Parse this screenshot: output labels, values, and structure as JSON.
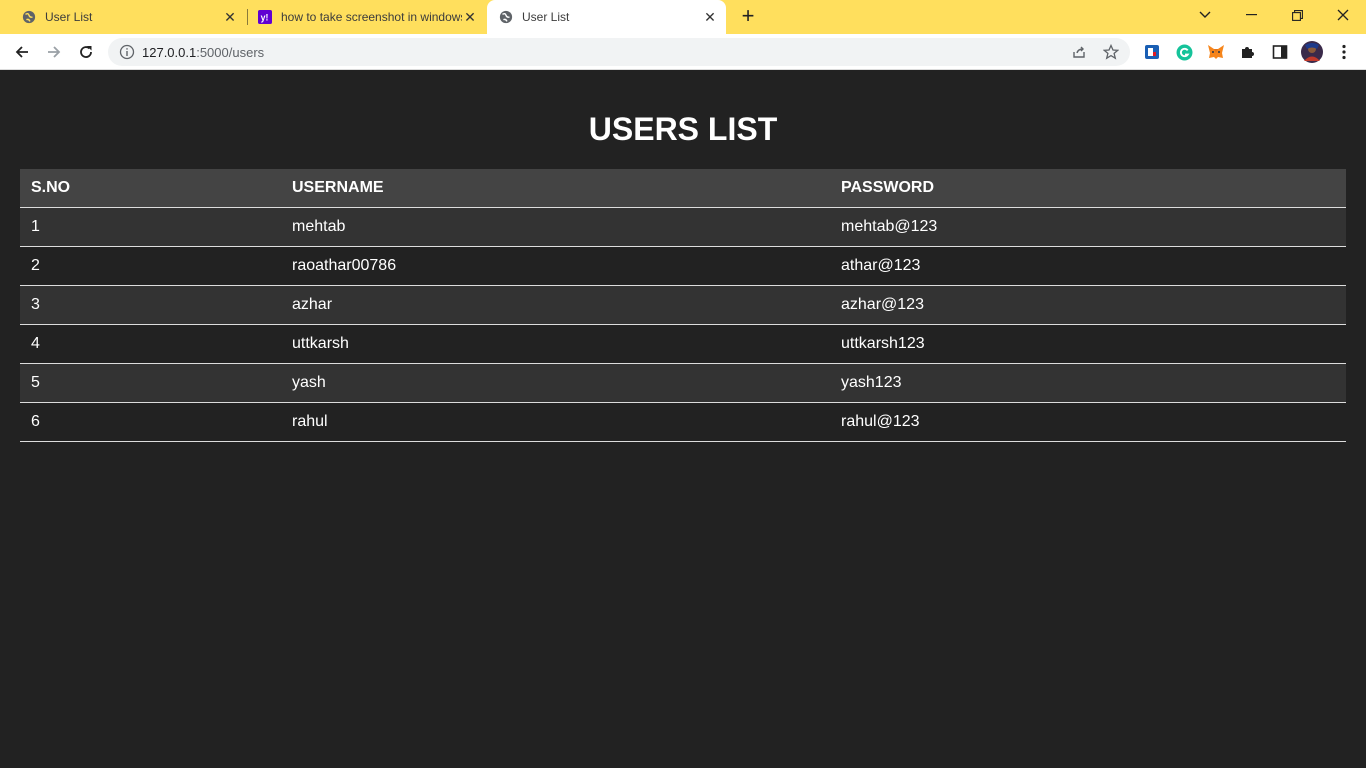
{
  "browser": {
    "tabs": [
      {
        "title": "User List"
      },
      {
        "title": "how to take screenshot in windows"
      },
      {
        "title": "User List"
      }
    ],
    "url_host": "127.0.0.1",
    "url_path": ":5000/users"
  },
  "page": {
    "title": "USERS LIST",
    "table": {
      "headers": [
        "S.NO",
        "USERNAME",
        "PASSWORD"
      ],
      "rows": [
        [
          "1",
          "mehtab",
          "mehtab@123"
        ],
        [
          "2",
          "raoathar00786",
          "athar@123"
        ],
        [
          "3",
          "azhar",
          "azhar@123"
        ],
        [
          "4",
          "uttkarsh",
          "uttkarsh123"
        ],
        [
          "5",
          "yash",
          "yash123"
        ],
        [
          "6",
          "rahul",
          "rahul@123"
        ]
      ]
    }
  },
  "colors": {
    "tabstrip": "#ffdf5d",
    "page_bg": "#222222",
    "header_bg": "#444444",
    "odd_row_bg": "#333333"
  }
}
